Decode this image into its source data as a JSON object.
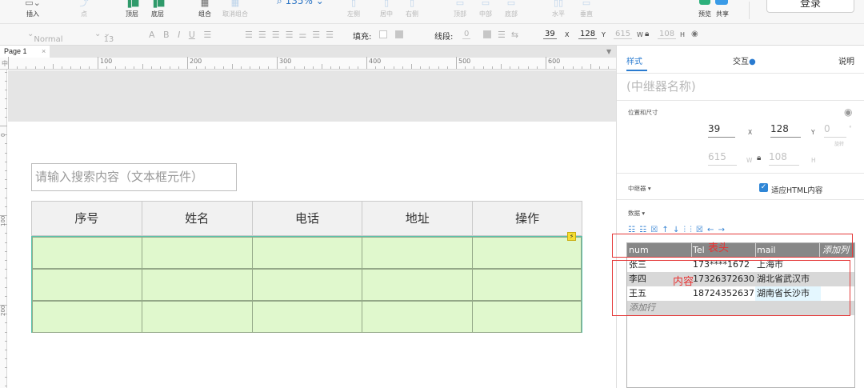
{
  "toolbar": {
    "tools": [
      {
        "label": "插入"
      },
      {
        "label": "点"
      },
      {
        "label": "顶层"
      },
      {
        "label": "底层"
      },
      {
        "label": "组合"
      },
      {
        "label": "取消组合"
      },
      {
        "label": "左侧"
      },
      {
        "label": "居中"
      },
      {
        "label": "右侧"
      },
      {
        "label": "顶部"
      },
      {
        "label": "中部"
      },
      {
        "label": "底部"
      },
      {
        "label": "水平"
      },
      {
        "label": "垂直"
      },
      {
        "label": "预览"
      },
      {
        "label": "共享"
      }
    ],
    "zoom": "135%",
    "login": "登录"
  },
  "format_bar": {
    "font_style": "Normal",
    "font_size": "13",
    "fill_label": "填充:",
    "line_label": "线段:",
    "line_value": "0",
    "x": "39",
    "x_label": "X",
    "y": "128",
    "y_label": "Y",
    "w": "615",
    "w_label": "W",
    "h": "108",
    "h_label": "H"
  },
  "page_tab": {
    "name": "Page 1",
    "close": "×"
  },
  "ruler": {
    "corner": "中",
    "h_labels": [
      "100",
      "200",
      "300",
      "400",
      "500",
      "600"
    ],
    "v_labels": [
      "0",
      "100",
      "200"
    ]
  },
  "canvas": {
    "search_placeholder": "请输入搜索内容（文本框元件）",
    "table_headers": [
      "序号",
      "姓名",
      "电话",
      "地址",
      "操作"
    ],
    "repeater_rows": 3
  },
  "panel": {
    "tabs": {
      "style": "样式",
      "interaction": "交互",
      "notes": "说明"
    },
    "name_placeholder": "(中继器名称)",
    "position_size_label": "位置和尺寸",
    "x": "39",
    "x_label": "X",
    "y": "128",
    "y_label": "Y",
    "rotation": "0",
    "rotation_unit": "°",
    "rotation_label": "旋转",
    "w": "615",
    "w_label": "W",
    "h": "108",
    "h_label": "H",
    "repeater_label": "中继器 ▾",
    "fit_html": "适应HTML内容",
    "data_label": "数据 ▾",
    "data_icons": "☷ ☷ ☒ ↑ ↓ ⫶ ⫶ ☒ ← →",
    "data_grid": {
      "columns": [
        "num",
        "Tel",
        "mail"
      ],
      "add_column": "添加列",
      "rows": [
        [
          "张三",
          "173****1672",
          "上海市"
        ],
        [
          "李四",
          "17326372630",
          "湖北省武汉市"
        ],
        [
          "王五",
          "18724352637",
          "湖南省长沙市"
        ]
      ],
      "add_row": "添加行"
    },
    "annotation_header": "表头",
    "annotation_content": "内容"
  },
  "colors": {
    "accent": "#2a7bd0",
    "repeater_fill": "#e0f8cd",
    "repeater_border": "#59c5ad",
    "annotation": "#e53a3a"
  }
}
